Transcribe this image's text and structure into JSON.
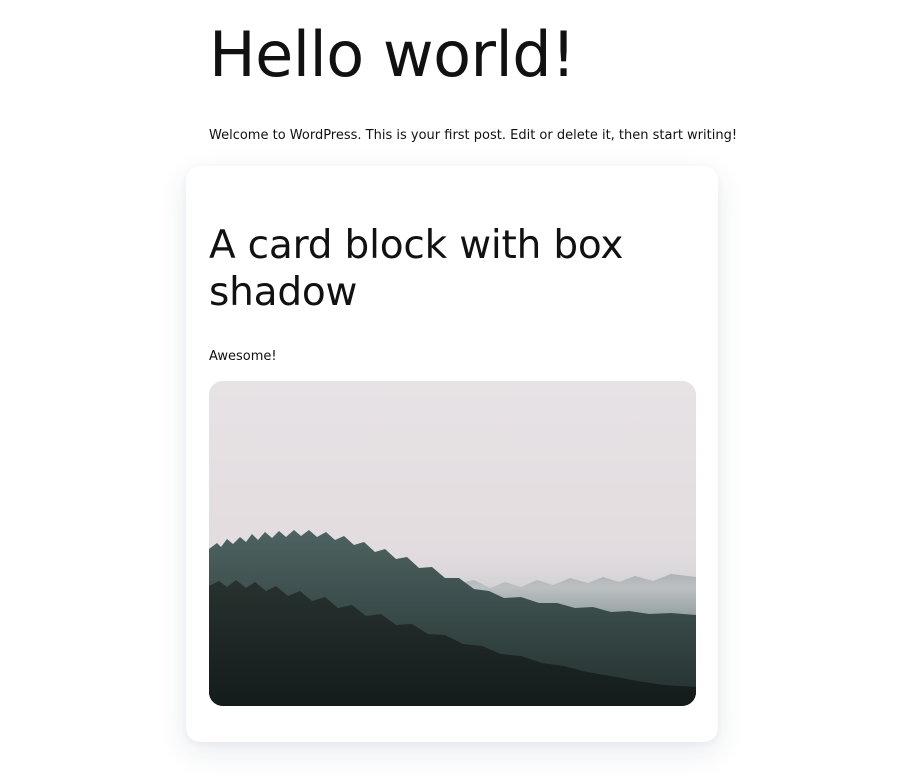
{
  "post": {
    "title": "Hello world!",
    "intro": "Welcome to WordPress. This is your first post. Edit or delete it, then start writing!"
  },
  "card": {
    "title": "A card block with box shadow",
    "text": "Awesome!",
    "image": {
      "subject": "misty-forest-hillside",
      "colors": {
        "sky": "#e6e1e4",
        "fog": "#cfcfd2",
        "far_trees": "#4f6467",
        "near_trees": "#1b2524"
      }
    }
  }
}
